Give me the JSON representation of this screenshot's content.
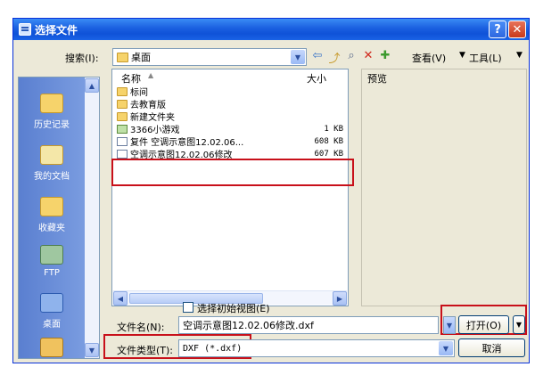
{
  "window": {
    "title": "选择文件",
    "help": "?",
    "close": "✕"
  },
  "toolbar": {
    "search_label": "搜索(I):",
    "location": "桌面",
    "view_label": "查看(V)",
    "tools_label": "工具(L)",
    "icons": [
      "back-arrow-icon",
      "up-folder-icon",
      "search-web-icon",
      "delete-icon",
      "new-folder-icon",
      "views-icon",
      "tools-dropdown-icon"
    ]
  },
  "places": [
    {
      "label": "历史记录",
      "icon": "history-icon"
    },
    {
      "label": "我的文档",
      "icon": "my-documents-icon"
    },
    {
      "label": "收藏夹",
      "icon": "favorites-icon"
    },
    {
      "label": "FTP",
      "icon": "ftp-icon"
    },
    {
      "label": "桌面",
      "icon": "desktop-icon"
    },
    {
      "label": "",
      "icon": "buzzsaw-icon"
    }
  ],
  "file_list": {
    "columns": {
      "name": "名称",
      "size": "大小"
    },
    "rows": [
      {
        "name": "标间",
        "size": "",
        "icon": "folder-icon"
      },
      {
        "name": "去教育版",
        "size": "",
        "icon": "folder-icon"
      },
      {
        "name": "新建文件夹",
        "size": "",
        "icon": "folder-icon"
      },
      {
        "name": "3366小游戏",
        "size": "1 KB",
        "icon": "shortcut-icon"
      },
      {
        "name": "复件 空调示意图12.02.06...",
        "size": "608 KB",
        "icon": "dxf-file-icon"
      },
      {
        "name": "空调示意图12.02.06修改",
        "size": "607 KB",
        "icon": "dxf-file-icon"
      }
    ]
  },
  "preview_label": "预览",
  "options": {
    "initial_view": "选择初始视图(E)"
  },
  "filename": {
    "label": "文件名(N):",
    "value": "空调示意图12.02.06修改.dxf"
  },
  "filetype": {
    "label": "文件类型(T):",
    "value": "DXF (*.dxf)"
  },
  "buttons": {
    "open": "打开(O)",
    "cancel": "取消"
  },
  "colors": {
    "titlebar": "#0f52d8",
    "highlight": "#c8101a",
    "dialog_bg": "#ece9d8"
  }
}
